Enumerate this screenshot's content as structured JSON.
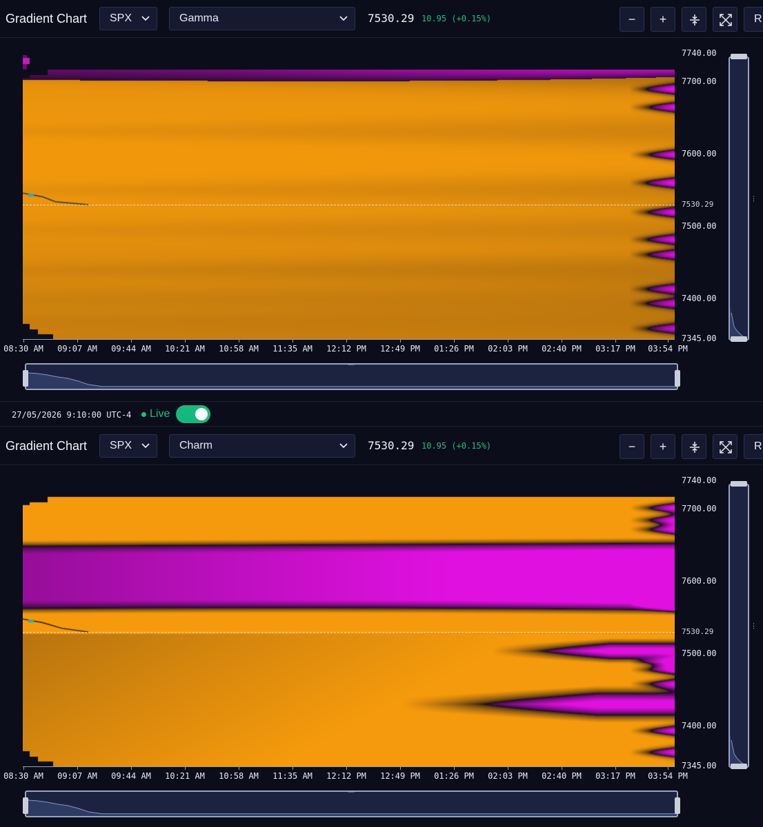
{
  "panels": [
    {
      "title": "Gradient Chart",
      "ticker": "SPX",
      "metric": "Gamma",
      "price": "7530.29",
      "change": "10.95 (+0.15%)",
      "buttons": {
        "zoom_out": "−",
        "zoom_in": "+",
        "right_partial": "R"
      },
      "icons": {
        "ticker_chevron": "chevron-down-icon",
        "metric_chevron": "chevron-down-icon",
        "fit": "compress-vertical-icon",
        "fullscreen": "expand-icon"
      },
      "current_price_label": "7530.29",
      "y_labels": [
        "7740.00",
        "7700.00",
        "7600.00",
        "7500.00",
        "7400.00",
        "7345.00"
      ],
      "x_labels": [
        "08:30 AM",
        "09:07 AM",
        "09:44 AM",
        "10:21 AM",
        "10:58 AM",
        "11:35 AM",
        "12:12 PM",
        "12:49 PM",
        "01:26 PM",
        "02:03 PM",
        "02:40 PM",
        "03:17 PM",
        "03:54 PM"
      ]
    },
    {
      "title": "Gradient Chart",
      "ticker": "SPX",
      "metric": "Charm",
      "price": "7530.29",
      "change": "10.95 (+0.15%)",
      "buttons": {
        "zoom_out": "−",
        "zoom_in": "+",
        "right_partial": "R"
      },
      "icons": {
        "ticker_chevron": "chevron-down-icon",
        "metric_chevron": "chevron-down-icon",
        "fit": "compress-vertical-icon",
        "fullscreen": "expand-icon"
      },
      "current_price_label": "7530.29",
      "y_labels": [
        "7740.00",
        "7700.00",
        "7600.00",
        "7500.00",
        "7400.00",
        "7345.00"
      ],
      "x_labels": [
        "08:30 AM",
        "09:07 AM",
        "09:44 AM",
        "10:21 AM",
        "10:58 AM",
        "11:35 AM",
        "12:12 PM",
        "12:49 PM",
        "01:26 PM",
        "02:03 PM",
        "02:40 PM",
        "03:17 PM",
        "03:54 PM"
      ]
    }
  ],
  "status": {
    "timestamp": "27/05/2026 9:10:00 UTC-4",
    "live_label": "Live",
    "live_enabled": true
  },
  "colors": {
    "background": "#0b0d1a",
    "positive": "#f59a0c",
    "negative": "#e010e0",
    "live": "#1fbf7a",
    "price_up": "#1fbf7a"
  },
  "chart_data": [
    {
      "type": "heatmap",
      "metric": "Gamma",
      "x_categories": [
        "08:30 AM",
        "09:07 AM",
        "09:44 AM",
        "10:21 AM",
        "10:58 AM",
        "11:35 AM",
        "12:12 PM",
        "12:49 PM",
        "01:26 PM",
        "02:03 PM",
        "02:40 PM",
        "03:17 PM",
        "03:54 PM"
      ],
      "ylim": [
        7345,
        7740
      ],
      "y_ticks": [
        7740,
        7700,
        7600,
        7500,
        7400,
        7345
      ],
      "current_price": 7530.29,
      "price_path": [
        [
          0,
          7548
        ],
        [
          0.3,
          7543
        ],
        [
          0.5,
          7536
        ],
        [
          1.0,
          7532
        ]
      ]
    },
    {
      "type": "heatmap",
      "metric": "Charm",
      "x_categories": [
        "08:30 AM",
        "09:07 AM",
        "09:44 AM",
        "10:21 AM",
        "10:58 AM",
        "11:35 AM",
        "12:12 PM",
        "12:49 PM",
        "01:26 PM",
        "02:03 PM",
        "02:40 PM",
        "03:17 PM",
        "03:54 PM"
      ],
      "ylim": [
        7345,
        7740
      ],
      "y_ticks": [
        7740,
        7700,
        7600,
        7500,
        7400,
        7345
      ],
      "current_price": 7530.29,
      "price_path": [
        [
          0,
          7550
        ],
        [
          0.3,
          7545
        ],
        [
          0.6,
          7537
        ],
        [
          1.0,
          7532
        ]
      ]
    }
  ]
}
